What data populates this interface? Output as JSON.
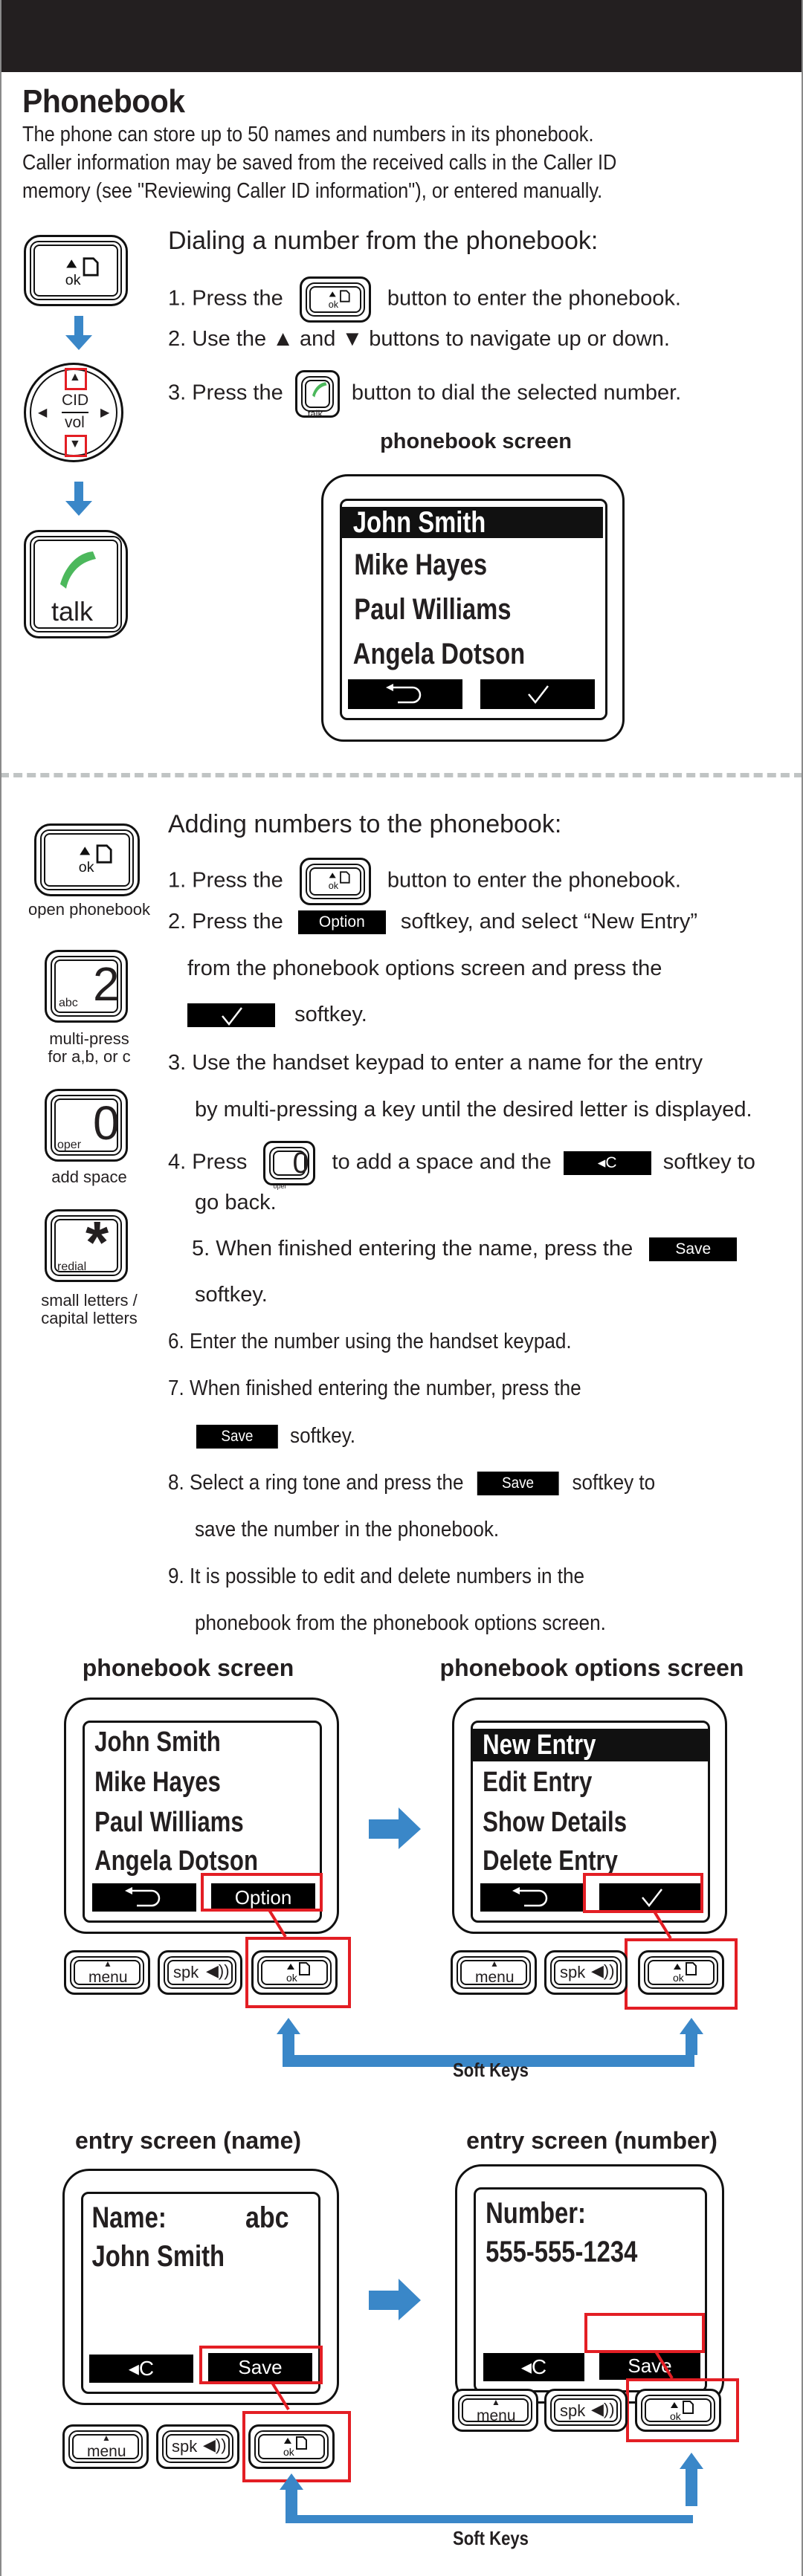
{
  "header": {
    "title": "Phonebook",
    "intro": "The phone can store up to 50 names and numbers in its phonebook.\nCaller information may be saved from the received calls in the Caller ID\nmemory (see \"Reviewing Caller ID information\"),  or entered manually."
  },
  "colors": {
    "top_bar": "#231f20",
    "accent_blue": "#3a87c8",
    "highlight_red": "#e31e24",
    "talk_green": "#4cb85c",
    "divider_gray": "#c0c4c4"
  },
  "dialing": {
    "heading": "Dialing a number from the phonebook:",
    "steps": [
      {
        "pre": "1. Press the",
        "icon": "ok-key-icon",
        "post": "button to enter the phonebook."
      },
      {
        "text": "2. Use the ▲ and ▼ buttons to navigate up or down."
      },
      {
        "pre": "3. Press the",
        "icon": "talk-key-icon",
        "post": "button to dial the selected number."
      }
    ],
    "side_keys": {
      "ok_label": "ok",
      "nav_up_label": "CID",
      "nav_down_label": "vol",
      "talk_label": "talk"
    },
    "screen": {
      "title": "phonebook screen",
      "rows": [
        "John Smith",
        "Mike Hayes",
        "Paul Williams",
        "Angela Dotson"
      ],
      "selected_index": 0,
      "softkeys": [
        "back-arrow-icon",
        "checkmark-icon"
      ]
    }
  },
  "adding": {
    "heading": "Adding numbers to the phonebook:",
    "side_keys": [
      {
        "glyph": "",
        "sub": "ok",
        "caption": "open phonebook"
      },
      {
        "glyph": "2",
        "sub": "abc",
        "caption": "multi-press\nfor a,b, or c"
      },
      {
        "glyph": "0",
        "sub": "oper",
        "caption": "add space"
      },
      {
        "glyph": "*",
        "sub": "redial",
        "caption": "small letters /\ncapital letters"
      }
    ],
    "steps": {
      "s1_pre": "1. Press the",
      "s1_post": "button to enter the phonebook.",
      "s2_pre": "2. Press the",
      "s2_badge": "Option",
      "s2_post": "softkey, and select “New Entry”",
      "s2_line2": "from the phonebook options screen and press the",
      "s2_line3_post": "softkey.",
      "s3_line1": "3. Use the handset keypad to enter a name for the entry",
      "s3_line2": "by multi-pressing a key until the desired letter is displayed.",
      "s4_pre": "4. Press",
      "s4_mid": "to add a space and the",
      "s4_badge": "◂C",
      "s4_post": "softkey to",
      "s4_line2": "go back.",
      "s5_pre": "5. When finished entering the name, press the",
      "s5_badge": "Save",
      "s5_line2": "softkey.",
      "s6": "6. Enter the number using the handset keypad.",
      "s7_line1": "7. When finished entering the number, press the",
      "s7_badge": "Save",
      "s7_post": "softkey.",
      "s8_pre": "8. Select a ring tone and press the",
      "s8_badge": "Save",
      "s8_post": "softkey to",
      "s8_line2": "save the number in the phonebook.",
      "s9_line1": "9. It is possible to edit and delete numbers in the",
      "s9_line2": "phonebook from the phonebook options screen."
    }
  },
  "diagrams": {
    "soft_keys_label": "Soft Keys",
    "hard_keys": {
      "menu": "menu",
      "spk": "spk",
      "ok": "ok"
    },
    "phonebook_screen": {
      "title": "phonebook screen",
      "rows": [
        "John Smith",
        "Mike Hayes",
        "Paul Williams",
        "Angela Dotson"
      ],
      "left_soft": "back-arrow-icon",
      "right_soft": "Option"
    },
    "options_screen": {
      "title": "phonebook options screen",
      "rows": [
        "New Entry",
        "Edit Entry",
        "Show Details",
        "Delete Entry"
      ],
      "selected_index": 0,
      "left_soft": "back-arrow-icon",
      "right_soft": "checkmark-icon"
    },
    "entry_name_screen": {
      "title": "entry screen (name)",
      "label": "Name:",
      "mode": "abc",
      "value": "John Smith",
      "left_soft": "◂C",
      "right_soft": "Save"
    },
    "entry_number_screen": {
      "title": "entry screen (number)",
      "label": "Number:",
      "value": "555-555-1234",
      "left_soft": "◂C",
      "right_soft": "Save"
    }
  }
}
